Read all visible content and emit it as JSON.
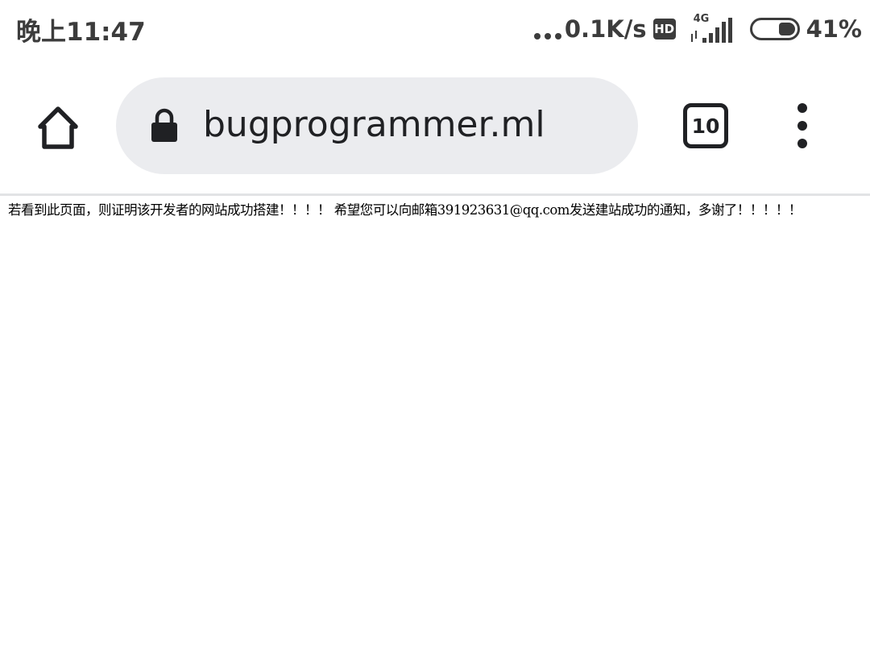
{
  "status_bar": {
    "time": "晚上11:47",
    "network_speed": "0.1K/s",
    "hd_label": "HD",
    "network_type": "4G",
    "battery_percent": "41%",
    "battery_level": 0.41,
    "icons": [
      "dots-icon",
      "hd-icon",
      "signal-icon",
      "battery-icon"
    ]
  },
  "toolbar": {
    "url": "bugprogrammer.ml",
    "tab_count": "10",
    "icons": [
      "home-icon",
      "lock-icon",
      "tabs-icon",
      "more-vert-icon"
    ]
  },
  "page": {
    "message": "若看到此页面，则证明该开发者的网站成功搭建！！！！ 希望您可以向邮箱391923631@qq.com发送建站成功的通知，多谢了！！！！！"
  },
  "colors": {
    "status_text": "#3c3c3c",
    "url_bar_bg": "#ebecef",
    "icon": "#202124",
    "page_bg": "#ffffff"
  }
}
